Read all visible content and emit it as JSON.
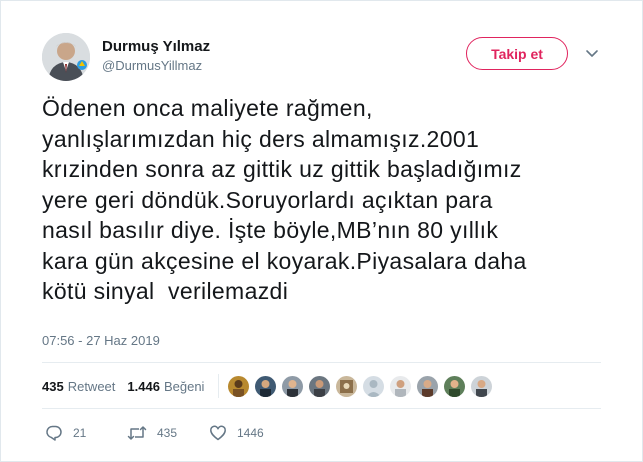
{
  "tweet": {
    "author": {
      "display_name": "Durmuş Yılmaz",
      "handle": "@DurmusYillmaz",
      "avatar_icon": "profile-photo"
    },
    "follow_button_label": "Takip et",
    "more_menu_icon": "chevron-down-icon",
    "text": "Ödenen onca maliyete rağmen,\nyanlışlarımızdan hiç ders almamışız.2001\nkrızinden sonra az gittik uz gittik başladığımız\nyere geri döndük.Soruyorlardı açıktan para\nnasıl basılır diye. İşte böyle,MB’nın 80 yıllık\nkara gün akçesine el koyarak.Piyasalara daha\nkötü sinyal  verilemazdi",
    "timestamp": "07:56 - 27 Haz 2019",
    "stats": {
      "retweet_count": "435",
      "retweet_label": "Retweet",
      "like_count": "1.446",
      "like_label": "Beğeni",
      "liker_avatar_count": 10
    },
    "actions": {
      "reply_count": "21",
      "retweet_count": "435",
      "like_count": "1446"
    }
  },
  "colors": {
    "text_primary": "#14171a",
    "text_secondary": "#657786",
    "follow_accent": "#e0245e",
    "divider": "#e6ecf0"
  }
}
